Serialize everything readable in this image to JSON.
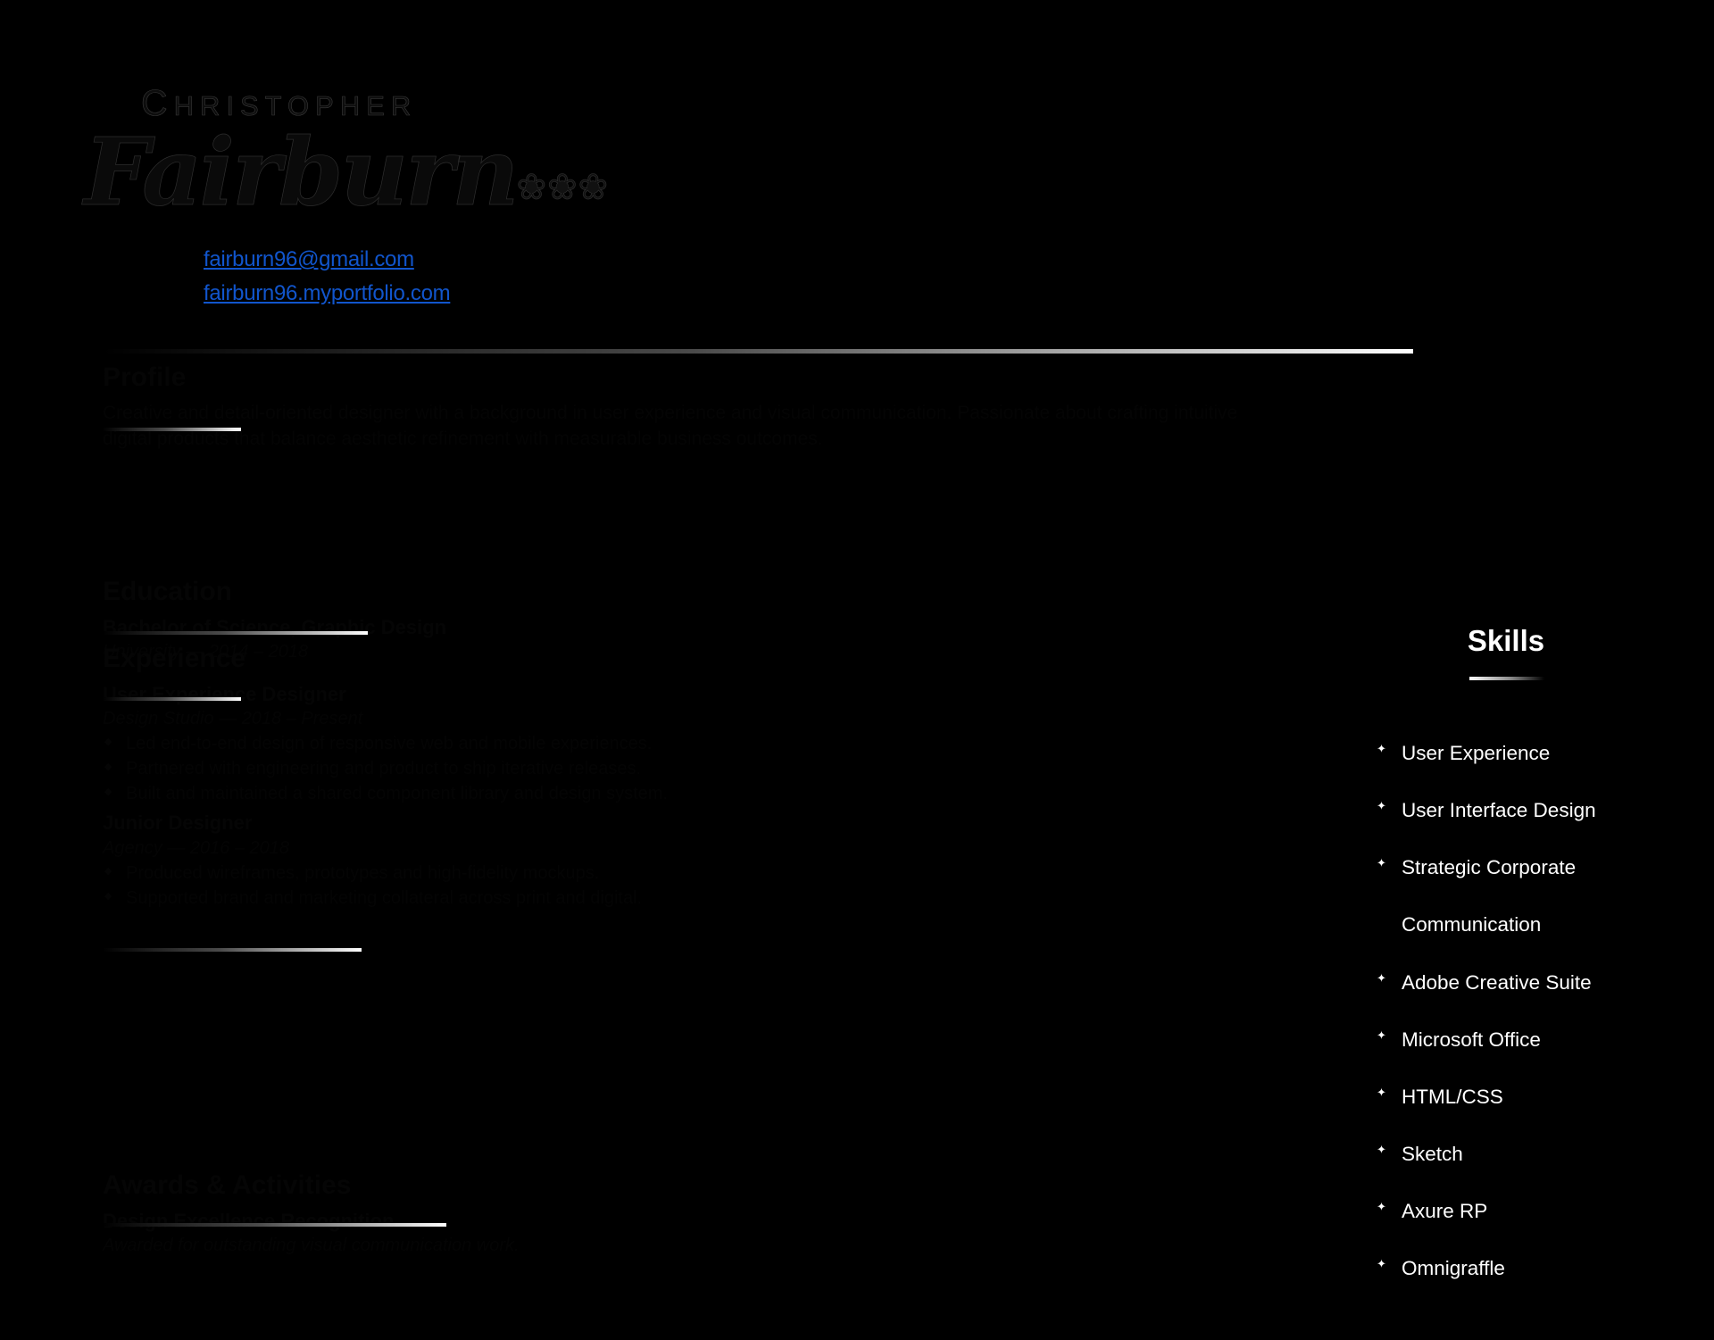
{
  "header": {
    "first_name": "CHRISTOPHER",
    "first_name_initial": "C",
    "first_name_rest": "HRISTOPHER",
    "last_name": "Fairburn",
    "flourish": "❀❀❀",
    "email": "fairburn96@gmail.com",
    "portfolio": "fairburn96.myportfolio.com"
  },
  "profile": {
    "heading": "Profile",
    "body": "Creative and detail-oriented designer with a background in user experience and visual communication. Passionate about crafting intuitive digital products that balance aesthetic refinement with measurable business outcomes."
  },
  "education": {
    "heading": "Education",
    "entries": [
      {
        "title": "Bachelor of Science, Graphic Design",
        "sub": "University — 2014 – 2018"
      }
    ]
  },
  "experience": {
    "heading": "Experience",
    "entries": [
      {
        "title": "User Experience Designer",
        "sub": "Design Studio — 2018 – Present",
        "bullets": [
          "Led end-to-end design of responsive web and mobile experiences.",
          "Partnered with engineering and product to ship iterative releases.",
          "Built and maintained a shared component library and design system."
        ]
      },
      {
        "title": "Junior Designer",
        "sub": "Agency — 2016 – 2018",
        "bullets": [
          "Produced wireframes, prototypes and high-fidelity mockups.",
          "Supported brand and marketing collateral across print and digital."
        ]
      }
    ]
  },
  "awards": {
    "heading": "Awards & Activities",
    "entries": [
      {
        "title": "Design Excellence Recognition",
        "sub": "Awarded for outstanding visual communication work."
      }
    ]
  },
  "skills": {
    "heading": "Skills",
    "bullet_glyph": "✦",
    "items": [
      {
        "label": "User Experience",
        "continuation": false
      },
      {
        "label": "User Interface Design",
        "continuation": false
      },
      {
        "label": "Strategic Corporate",
        "continuation": false
      },
      {
        "label": "Communication",
        "continuation": true
      },
      {
        "label": "Adobe Creative Suite",
        "continuation": false
      },
      {
        "label": "Microsoft Office",
        "continuation": false
      },
      {
        "label": "HTML/CSS",
        "continuation": false
      },
      {
        "label": "Sketch",
        "continuation": false
      },
      {
        "label": "Axure RP",
        "continuation": false
      },
      {
        "label": "Omnigraffle",
        "continuation": false
      }
    ]
  },
  "colors": {
    "background": "#000000",
    "link": "#1155cc",
    "text_light": "#ffffff",
    "text_hidden": "#050505"
  }
}
